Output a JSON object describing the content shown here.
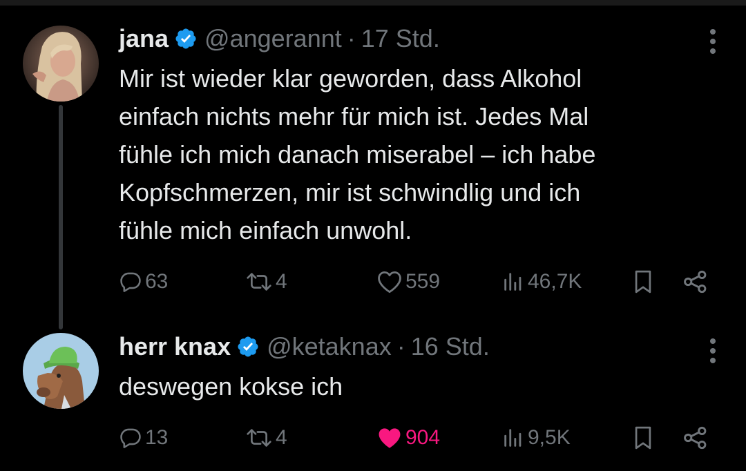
{
  "tweets": [
    {
      "name": "jana",
      "handle": "@angerannt",
      "separator": "·",
      "time": "17 Std.",
      "text": "Mir ist wieder klar geworden, dass Alkohol\neinfach nichts mehr für mich ist. Jedes Mal\nfühle ich mich danach miserabel – ich habe\nKopfschmerzen, mir ist schwindlig und ich\nfühle mich einfach unwohl.",
      "replies": "63",
      "retweets": "4",
      "likes": "559",
      "views": "46,7K",
      "liked": false
    },
    {
      "name": "herr knax",
      "handle": "@ketaknax",
      "separator": "·",
      "time": "16 Std.",
      "text": "deswegen kokse ich",
      "replies": "13",
      "retweets": "4",
      "likes": "904",
      "views": "9,5K",
      "liked": true
    }
  ],
  "icons": {
    "verified": "verified-badge-icon",
    "more": "more-options-icon",
    "reply": "reply-icon",
    "retweet": "retweet-icon",
    "like": "heart-icon",
    "views": "views-icon",
    "bookmark": "bookmark-icon",
    "share": "share-icon"
  },
  "colors": {
    "background": "#000000",
    "text": "#e7e9ea",
    "muted": "#71767b",
    "verified": "#1d9bf0",
    "liked": "#f91880",
    "thread_line": "#333639"
  }
}
